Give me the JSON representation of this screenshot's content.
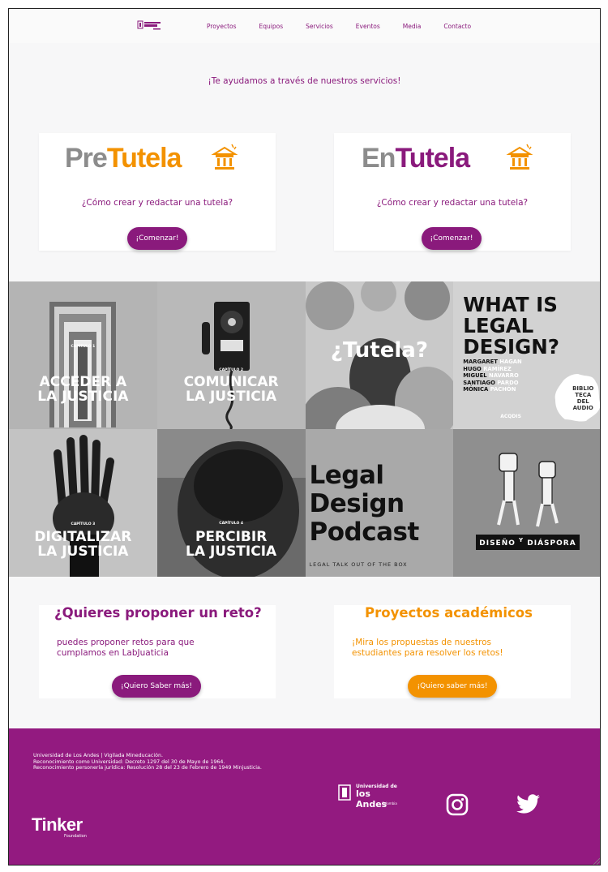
{
  "nav": {
    "items": [
      "Proyectos",
      "Equipos",
      "Servicios",
      "Eventos",
      "Media",
      "Contacto"
    ]
  },
  "intro": "¡Te ayudamos a través de nuestros servicios!",
  "services": [
    {
      "brand_prefix": "Pre",
      "brand_main": "Tutela",
      "question": "¿Cómo crear y redactar una tutela?",
      "button": "¡Comenzar!"
    },
    {
      "brand_prefix": "En",
      "brand_main": "Tutela",
      "question": "¿Cómo crear y redactar una tutela?",
      "button": "¡Comenzar!"
    }
  ],
  "tiles": [
    {
      "chapter": "CAPÍTULO 1",
      "line1": "ACCEDER A",
      "line2": "LA JUSTICIA"
    },
    {
      "chapter": "CAPÍTULO 2",
      "line1": "COMUNICAR",
      "line2": "LA JUSTICIA"
    },
    {
      "title": "¿Tutela?"
    },
    {
      "title_lines": [
        "WHAT IS",
        "LEGAL",
        "DESIGN?"
      ],
      "names": [
        [
          "MARGARET",
          "HAGAN"
        ],
        [
          "HUGO",
          "RAMÍREZ"
        ],
        [
          "MIGUEL",
          "NAVARRO"
        ],
        [
          "SANTIAGO",
          "PARDO"
        ],
        [
          "MÓNICA",
          "PACHÓN"
        ]
      ],
      "badge": [
        "BIBLIO",
        "TECA",
        "DEL",
        "AUDIO"
      ],
      "logo_text": "ACQDIS"
    },
    {
      "chapter": "CAPÍTULO 3",
      "line1": "DIGITALIZAR",
      "line2": "LA JUSTICIA"
    },
    {
      "chapter": "CAPÍTULO 4",
      "line1": "PERCIBIR",
      "line2": "LA JUSTICIA"
    },
    {
      "title_lines": [
        "Legal",
        "Design",
        "Podcast"
      ],
      "subtitle": "LEGAL TALK OUT OF THE BOX"
    },
    {
      "label_a": "DISEÑO",
      "label_y": "Y",
      "label_b": "DIÁSPORA"
    }
  ],
  "reto": {
    "title": "¿Quieres proponer un reto?",
    "text_1": "puedes proponer retos para que",
    "text_2": "cumplamos en LabJuaticia",
    "button": "¡Quiero Saber más!"
  },
  "proyectos": {
    "title": "Proyectos académicos",
    "text_1": "¡Mira los propuestas de nuestros",
    "text_2": "estudiantes para resolver los retos!",
    "button": "¡Quiero saber más!"
  },
  "footer": {
    "legal_1": "Universidad de Los Andes | Vigilada Mineducación.",
    "legal_2": "Reconocimiento como Universidad: Decreto 1297 del 30 de Mayo de 1964.",
    "legal_3": "Reconocimiento personería jurídica: Resolución 28 del 23 de Febrero de 1949 Minjusticia.",
    "tinker": "Tinker",
    "foundation": "Foundation",
    "uni_line1": "Universidad de",
    "uni_line2": "los Andes",
    "uni_line3": "Colombia",
    "icons": [
      "instagram-icon",
      "twitter-icon"
    ]
  },
  "colors": {
    "purple": "#8a1a7c",
    "orange": "#f39200",
    "footer": "#931a80"
  }
}
